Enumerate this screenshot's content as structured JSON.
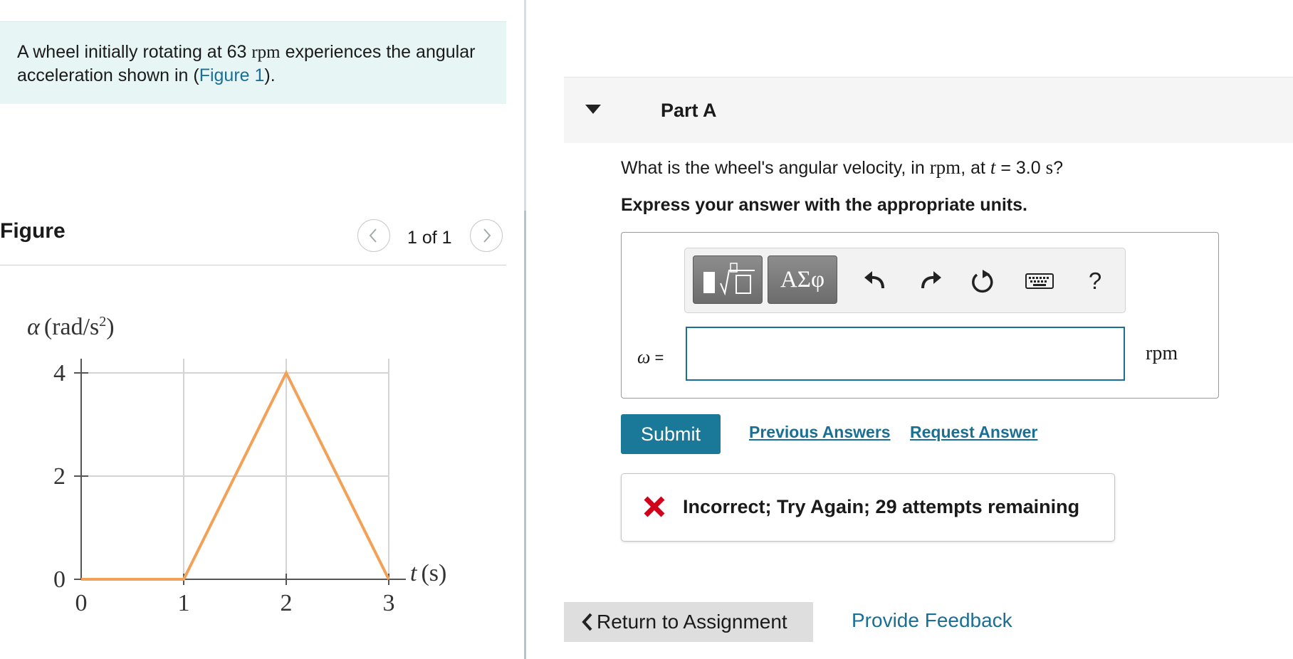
{
  "problem": {
    "text_before": "A wheel initially rotating at 63 ",
    "unit_rpm": "rpm",
    "text_middle": " experiences the angular acceleration shown in (",
    "figure_link": "Figure 1",
    "text_after": ")."
  },
  "figure": {
    "title": "Figure",
    "pagination": "1 of 1",
    "prev_icon": "chevron-left-icon",
    "next_icon": "chevron-right-icon"
  },
  "chart_data": {
    "type": "line",
    "ylabel_symbol": "α",
    "ylabel_unit": "(rad/s",
    "ylabel_exp": "2",
    "ylabel_close": ")",
    "xlabel_symbol": "t",
    "xlabel_unit": "(s)",
    "x_ticks": [
      "0",
      "1",
      "2",
      "3"
    ],
    "y_ticks": [
      "0",
      "2",
      "4"
    ],
    "xlim": [
      0,
      3
    ],
    "ylim": [
      0,
      4
    ],
    "grid": true,
    "series": [
      {
        "color": "#f4a158",
        "x": [
          0,
          1,
          2,
          3
        ],
        "y": [
          0,
          0,
          4,
          0
        ]
      }
    ]
  },
  "part": {
    "title": "Part A",
    "question_before": "What is the wheel's angular velocity, in ",
    "question_unit": "rpm",
    "question_mid": ", at ",
    "question_var": "t",
    "question_eq": " = 3.0 ",
    "question_s": "s",
    "question_end": "?",
    "instructions": "Express your answer with the appropriate units."
  },
  "toolbar": {
    "symbols_label": "ΑΣφ",
    "help_label": "?",
    "icons": [
      "templates-icon",
      "undo-icon",
      "redo-icon",
      "reset-icon",
      "keyboard-icon",
      "help-icon"
    ]
  },
  "answer": {
    "variable": "ω",
    "equals": "=",
    "value": "",
    "units": "rpm"
  },
  "actions": {
    "submit": "Submit",
    "previous_answers": "Previous Answers",
    "request_answer": "Request Answer"
  },
  "feedback": {
    "message": "Incorrect; Try Again; 29 attempts remaining",
    "icon": "x-mark-icon",
    "icon_color": "#d0021b"
  },
  "footer": {
    "return": "Return to Assignment",
    "provide_feedback": "Provide Feedback"
  },
  "colors": {
    "accent": "#1a7898",
    "link": "#1a6f95",
    "problem_bg": "#e8f5f5"
  }
}
